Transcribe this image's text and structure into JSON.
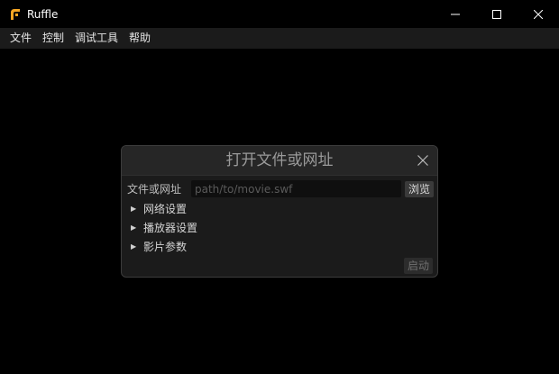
{
  "window": {
    "title": "Ruffle",
    "logo_icon": "ruffle-logo",
    "controls": [
      "minimize-icon",
      "maximize-icon",
      "close-icon"
    ]
  },
  "menu": {
    "items": [
      "文件",
      "控制",
      "调试工具",
      "帮助"
    ]
  },
  "dialog": {
    "title": "打开文件或网址",
    "url_label": "文件或网址",
    "url_value": "",
    "url_placeholder": "path/to/movie.swf",
    "browse_label": "浏览",
    "sections": [
      "网络设置",
      "播放器设置",
      "影片参数"
    ],
    "start_label": "启动"
  },
  "colors": {
    "background": "#000000",
    "menubar": "#1b1b1b",
    "dialog": "#1b1b1b",
    "accent_logo": "#f5a623"
  }
}
